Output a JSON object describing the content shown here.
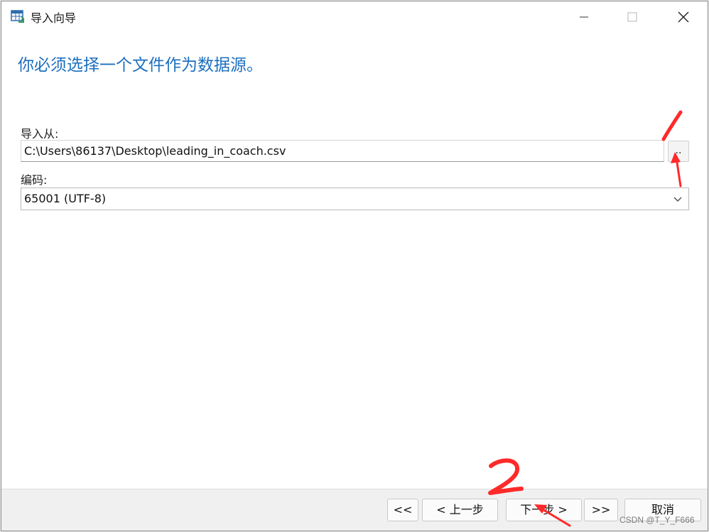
{
  "window": {
    "title": "导入向导",
    "icon": "table-import-icon",
    "controls": [
      "minimize-icon",
      "maximize-icon",
      "close-icon"
    ]
  },
  "page": {
    "heading": "你必须选择一个文件作为数据源。"
  },
  "form": {
    "import_from_label": "导入从:",
    "file_path": "C:\\Users\\86137\\Desktop\\leading_in_coach.csv",
    "browse_label": "..",
    "encoding_label": "编码:",
    "encoding_value": "65001 (UTF-8)"
  },
  "footer": {
    "first_label": "<<",
    "prev_label": "< 上一步",
    "next_label": "下一步 >",
    "last_label": ">>",
    "cancel_label": "取消"
  },
  "annotations": {
    "mark_1": "1",
    "mark_2": "2",
    "color": "#ff2a2a"
  },
  "watermark": "CSDN @T_Y_F666",
  "colors": {
    "heading": "#1d6fbf",
    "footer_bg": "#f0f0f0",
    "window_bg": "#ffffff"
  }
}
